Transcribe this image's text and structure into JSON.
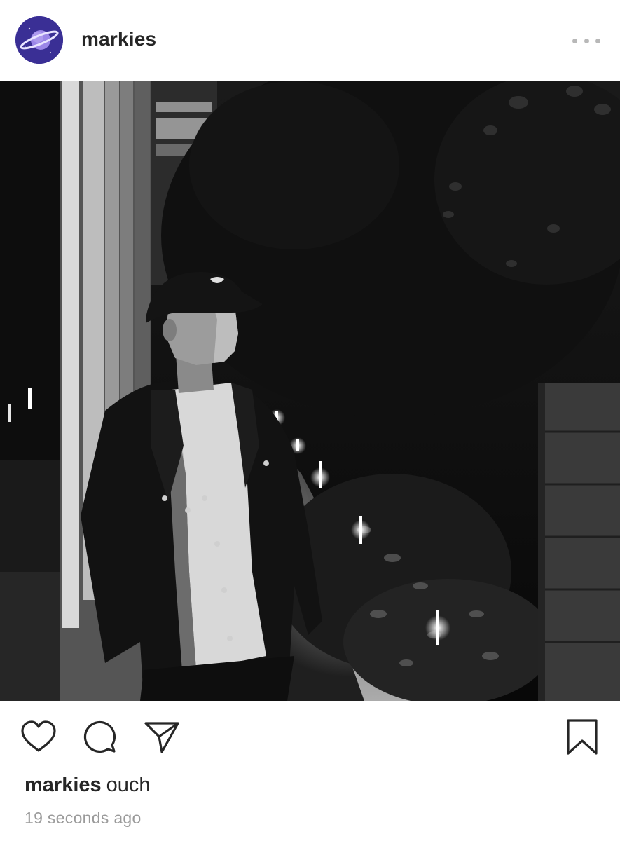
{
  "header": {
    "username": "markies",
    "avatar_icon": "planet-icon",
    "more_icon": "more-options-icon"
  },
  "actions": {
    "like_icon": "heart-icon",
    "comment_icon": "comment-icon",
    "share_icon": "paper-plane-icon",
    "save_icon": "bookmark-icon"
  },
  "caption": {
    "username": "markies",
    "text": "ouch"
  },
  "timestamp": "19 seconds ago",
  "colors": {
    "text": "#262626",
    "secondary_text": "#9a9a9a",
    "background": "#ffffff"
  }
}
